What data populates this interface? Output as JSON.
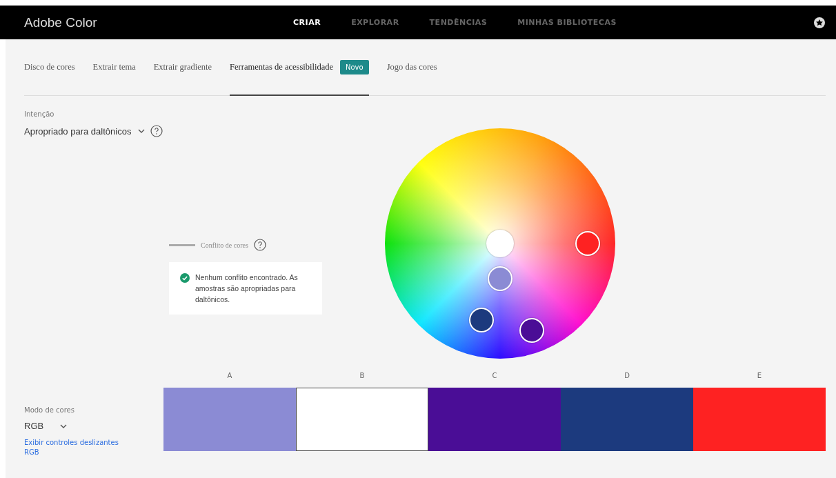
{
  "app": {
    "title": "Adobe Color"
  },
  "nav": [
    {
      "label": "CRIAR",
      "selected": true
    },
    {
      "label": "EXPLORAR",
      "selected": false
    },
    {
      "label": "TENDÊNCIAS",
      "selected": false
    },
    {
      "label": "MINHAS BIBLIOTECAS",
      "selected": false
    }
  ],
  "tabs": [
    {
      "label": "Disco de cores",
      "selected": false
    },
    {
      "label": "Extrair tema",
      "selected": false
    },
    {
      "label": "Extrair gradiente",
      "selected": false
    },
    {
      "label": "Ferramentas de acessibilidade",
      "selected": true,
      "badge": "Novo"
    },
    {
      "label": "Jogo das cores",
      "selected": false
    }
  ],
  "intent": {
    "label": "Intenção",
    "value": "Apropriado para daltônicos"
  },
  "legend": {
    "label": "Conflito de cores"
  },
  "message": {
    "text": "Nenhum conflito encontrado. As amostras são apropriadas para daltônicos."
  },
  "swatches": [
    {
      "label": "A",
      "color": "#8b8bd4",
      "selected": false
    },
    {
      "label": "B",
      "color": "#ffffff",
      "selected": true
    },
    {
      "label": "C",
      "color": "#4a0d96",
      "selected": false
    },
    {
      "label": "D",
      "color": "#1c3a7e",
      "selected": false
    },
    {
      "label": "E",
      "color": "#fe2222",
      "selected": false
    }
  ],
  "color_mode": {
    "label": "Modo de cores",
    "value": "RGB",
    "link": "Exibir controles deslizantes RGB"
  }
}
